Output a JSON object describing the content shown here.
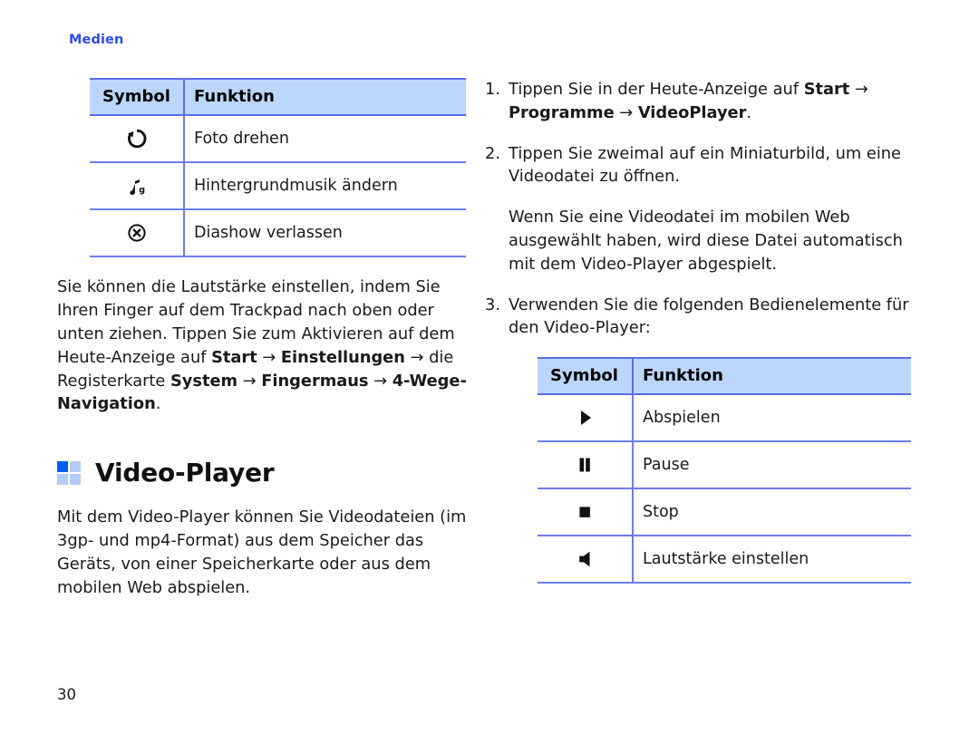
{
  "page": {
    "running_head": "Medien",
    "folio": "30"
  },
  "colors": {
    "accent_blue": "#2b4df0",
    "table_header_bg": "#bcd6fb",
    "table_border": "#6d7dec",
    "heading_square_on": "#0a5cf5",
    "heading_square_off": "#b3cbf7",
    "text": "#1a1a1a"
  },
  "left_column": {
    "table": {
      "headers": [
        "Symbol",
        "Funktion"
      ],
      "rows": [
        {
          "icon": "rotate-photo-icon",
          "function": "Foto drehen"
        },
        {
          "icon": "music-note-icon",
          "function": "Hintergrundmusik ändern"
        },
        {
          "icon": "circle-x-icon",
          "function": "Diashow verlassen"
        }
      ]
    },
    "paragraph": {
      "segments": [
        {
          "text": "Sie können die Lautstärke einstellen, indem Sie Ihren Finger auf dem Trackpad nach oben oder unten ziehen. Tippen Sie zum Aktivieren auf dem Heute-Anzeige auf ",
          "bold": false
        },
        {
          "text": "Start",
          "bold": true
        },
        {
          "text": " → ",
          "bold": false
        },
        {
          "text": "Einstellungen",
          "bold": true
        },
        {
          "text": " → die Registerkarte ",
          "bold": false
        },
        {
          "text": "System",
          "bold": true
        },
        {
          "text": " → ",
          "bold": false
        },
        {
          "text": "Fingermaus",
          "bold": true
        },
        {
          "text": " → ",
          "bold": false
        },
        {
          "text": "4-Wege-Navigation",
          "bold": true
        },
        {
          "text": ".",
          "bold": false
        }
      ]
    },
    "section_heading": {
      "icon": "four-squares-icon",
      "title": "Video-Player"
    },
    "section_paragraph": "Mit dem Video-Player können Sie Videodateien (im 3gp- und mp4-Format) aus dem Speicher das Geräts, von einer Speicherkarte oder aus dem mobilen Web abspielen."
  },
  "right_column": {
    "steps": [
      {
        "number": "1.",
        "segments": [
          {
            "text": "Tippen Sie in der Heute-Anzeige auf ",
            "bold": false
          },
          {
            "text": "Start",
            "bold": true
          },
          {
            "text": " → ",
            "bold": false
          },
          {
            "text": "Programme",
            "bold": true
          },
          {
            "text": " → ",
            "bold": false
          },
          {
            "text": "VideoPlayer",
            "bold": true
          },
          {
            "text": ".",
            "bold": false
          }
        ]
      },
      {
        "number": "2.",
        "segments": [
          {
            "text": "Tippen Sie zweimal auf ein Miniaturbild, um eine Videodatei zu öffnen.",
            "bold": false
          }
        ]
      }
    ],
    "note_paragraph": "Wenn Sie eine Videodatei im mobilen Web ausgewählt haben, wird diese Datei automatisch mit dem Video-Player abgespielt.",
    "step3": {
      "number": "3.",
      "segments": [
        {
          "text": "Verwenden Sie die folgenden Bedienelemente für den Video-Player:",
          "bold": false
        }
      ]
    },
    "table": {
      "headers": [
        "Symbol",
        "Funktion"
      ],
      "rows": [
        {
          "icon": "play-icon",
          "function": "Abspielen"
        },
        {
          "icon": "pause-icon",
          "function": "Pause"
        },
        {
          "icon": "stop-icon",
          "function": "Stop"
        },
        {
          "icon": "speaker-volume-icon",
          "function": "Lautstärke einstellen"
        }
      ]
    }
  }
}
